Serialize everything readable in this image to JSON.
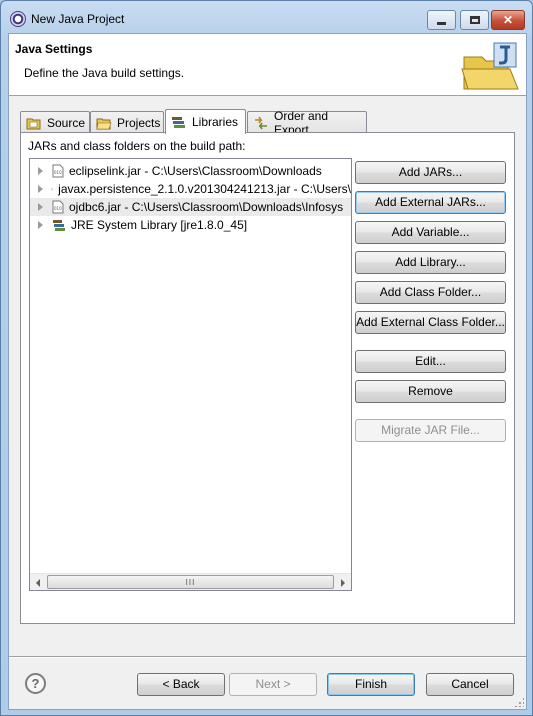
{
  "window": {
    "title": "New Java Project"
  },
  "header": {
    "title": "Java Settings",
    "description": "Define the Java build settings."
  },
  "tabs": [
    {
      "label": "Source",
      "icon": "source-folder-icon",
      "active": false
    },
    {
      "label": "Projects",
      "icon": "projects-folder-icon",
      "active": false
    },
    {
      "label": "Libraries",
      "icon": "libraries-icon",
      "active": true
    },
    {
      "label": "Order and Export",
      "icon": "order-export-icon",
      "active": false
    }
  ],
  "libraries": {
    "caption": "JARs and class folders on the build path:",
    "entries": [
      {
        "label": "eclipselink.jar - C:\\Users\\Classroom\\Downloads",
        "icon": "jar-icon",
        "selected": false
      },
      {
        "label": "javax.persistence_2.1.0.v201304241213.jar - C:\\Users\\",
        "icon": "jar-icon",
        "selected": false
      },
      {
        "label": "ojdbc6.jar - C:\\Users\\Classroom\\Downloads\\Infosys",
        "icon": "jar-icon",
        "selected": true
      },
      {
        "label": "JRE System Library [jre1.8.0_45]",
        "icon": "library-icon",
        "selected": false
      }
    ],
    "scroll_thumb_glyph": "III"
  },
  "side_buttons": {
    "add_jars": "Add JARs...",
    "add_external_jars": "Add External JARs...",
    "add_variable": "Add Variable...",
    "add_library": "Add Library...",
    "add_class_folder": "Add Class Folder...",
    "add_external_class_folder": "Add External Class Folder...",
    "edit": "Edit...",
    "remove": "Remove",
    "migrate_jar": "Migrate JAR File..."
  },
  "footer": {
    "help_glyph": "?",
    "back": "< Back",
    "next": "Next >",
    "finish": "Finish",
    "cancel": "Cancel"
  }
}
